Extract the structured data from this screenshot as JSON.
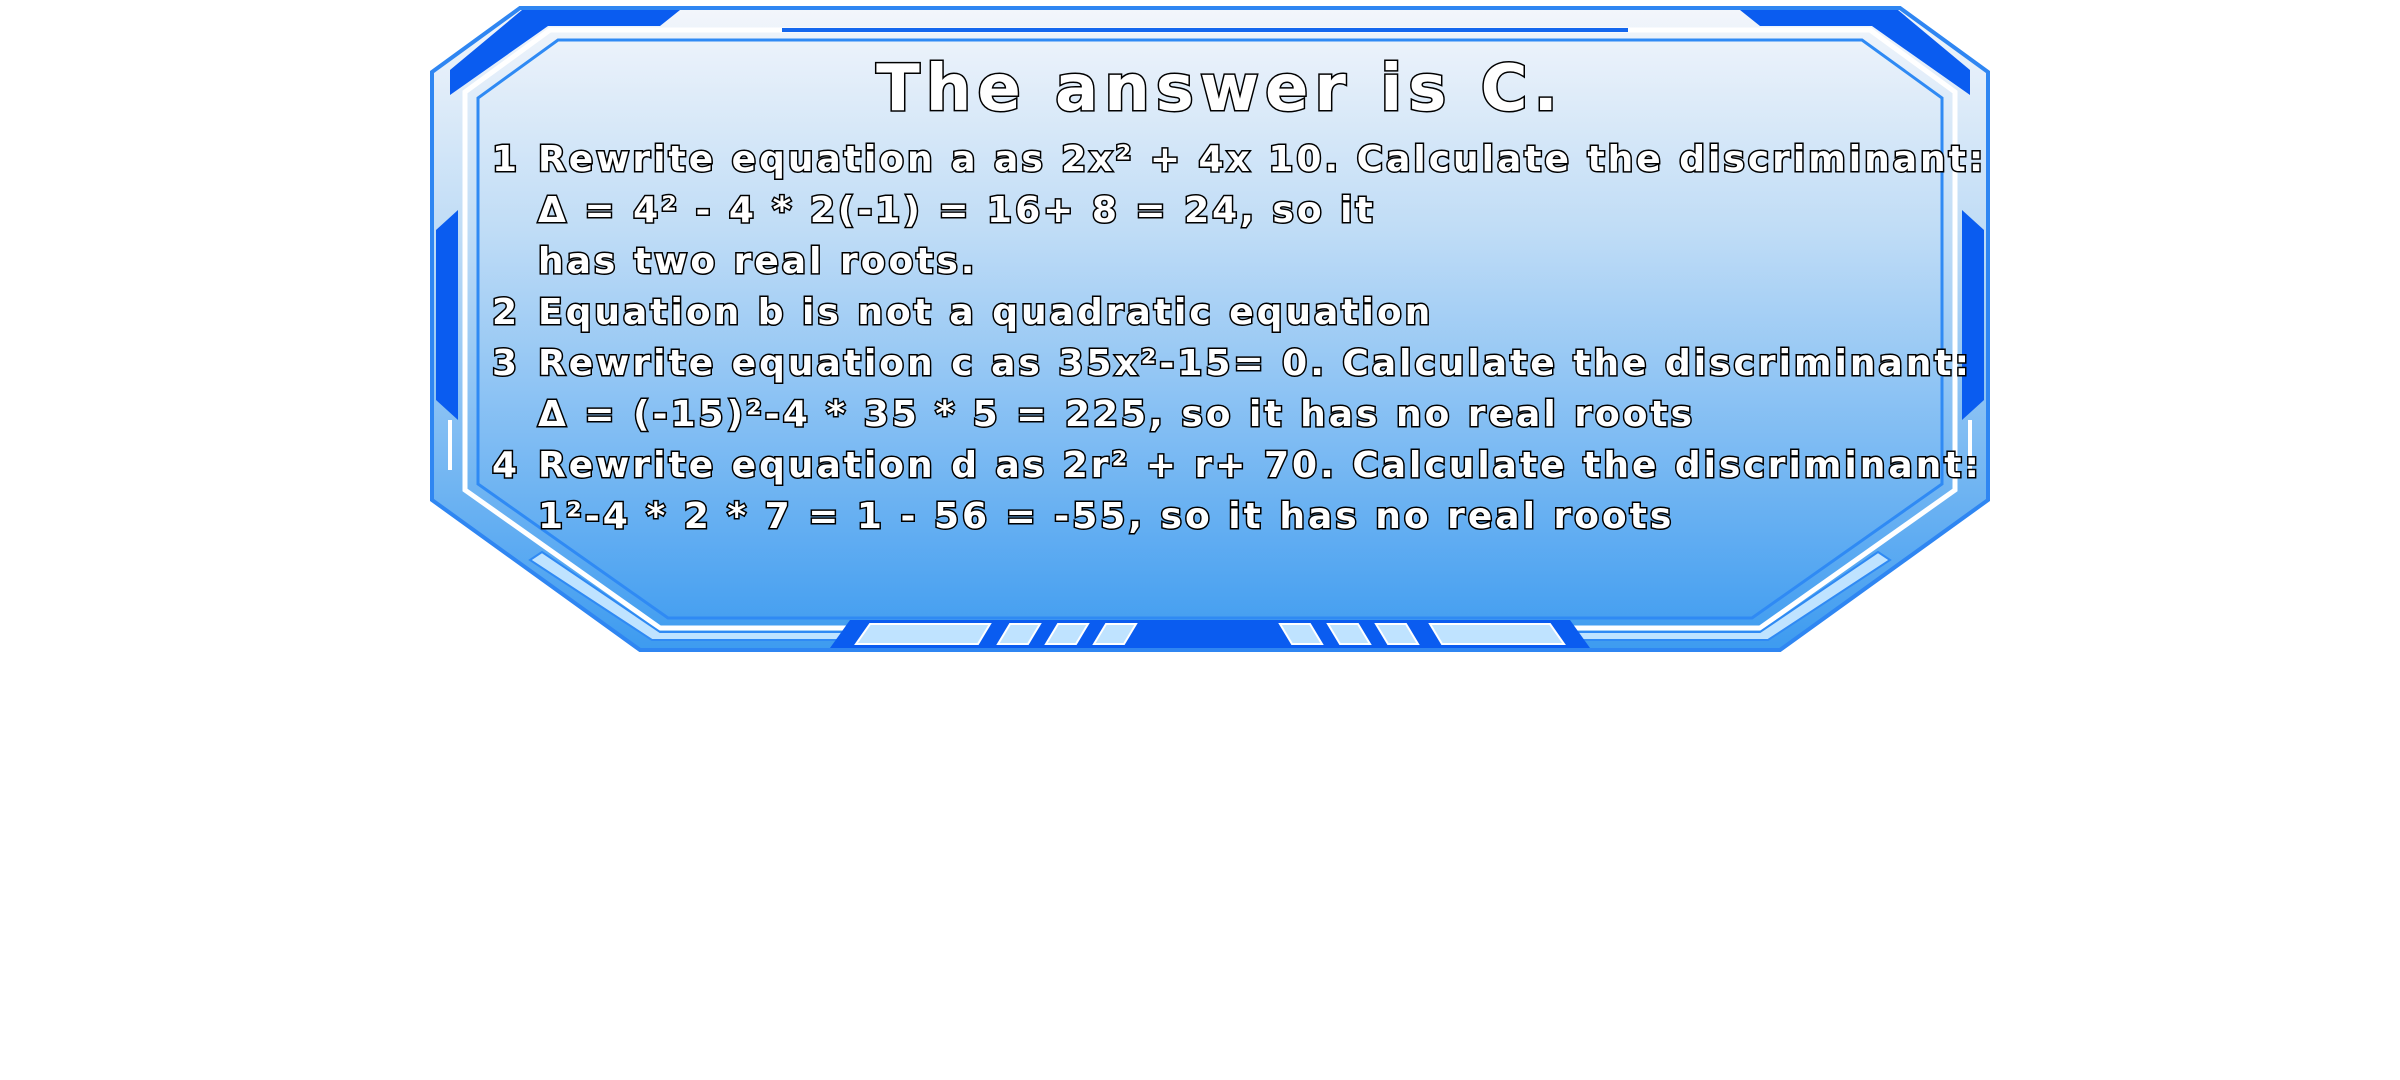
{
  "colors": {
    "frame_primary": "#0a5cf0",
    "frame_light": "#9ed0ff",
    "panel_top": "#f2f6fb",
    "panel_bottom": "#3e9cf0",
    "text_fill": "#ffffff",
    "text_stroke": "#000000"
  },
  "title": "The answer is C.",
  "steps": [
    {
      "number": "1",
      "lines": [
        "Rewrite equation a as 2x² + 4x 10. Calculate the discriminant:",
        "Δ = 4² - 4 * 2(-1) = 16+ 8 = 24, so it",
        "has two real roots."
      ]
    },
    {
      "number": "2",
      "lines": [
        "Equation b is not a quadratic equation"
      ]
    },
    {
      "number": "3",
      "lines": [
        "Rewrite equation c as 35x²-15= 0. Calculate the discriminant:",
        "Δ = (-15)²-4 * 35 * 5 = 225, so it has no real roots"
      ]
    },
    {
      "number": "4",
      "lines": [
        "Rewrite equation d as 2r² + r+ 70. Calculate the discriminant:",
        "1²-4 * 2 * 7 = 1 - 56 = -55, so it has no real roots"
      ]
    }
  ]
}
